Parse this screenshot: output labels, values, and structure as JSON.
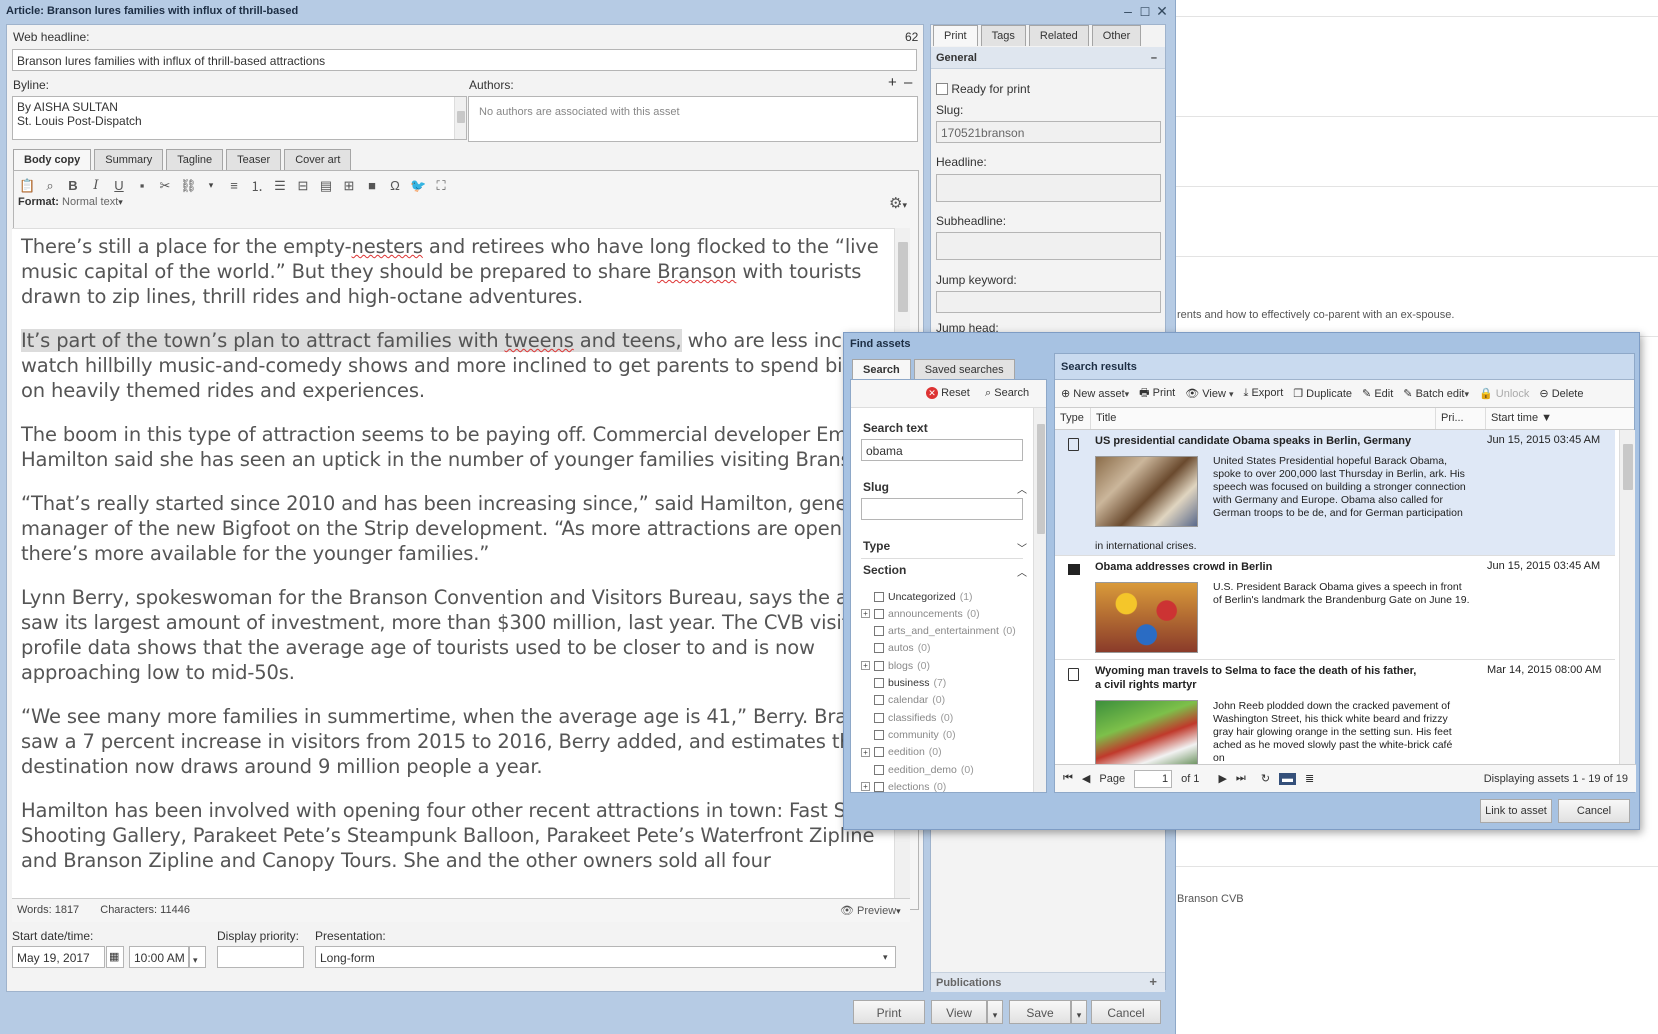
{
  "window": {
    "title": "Article: Branson lures families with influx of thrill-based"
  },
  "web_headline": {
    "label": "Web headline:",
    "count": "62",
    "value": "Branson lures families with influx of thrill-based attractions"
  },
  "byline": {
    "label": "Byline:",
    "line1": "By AISHA SULTAN",
    "line2": "St. Louis Post-Dispatch"
  },
  "authors": {
    "label": "Authors:",
    "empty": "No authors are associated with this asset"
  },
  "editor_tabs": [
    "Body copy",
    "Summary",
    "Tagline",
    "Teaser",
    "Cover art"
  ],
  "format": {
    "label": "Format:",
    "value": "Normal text"
  },
  "body": [
    "There’s still a place for the empty-nesters and retirees who have long flocked to the “live music capital of the world.” But they should be prepared to share Branson with tourists drawn to zip lines, thrill rides and high-octane adventures.",
    "It’s part of the town’s plan to attract families with tweens and teens, who are less inclined to watch hillbilly music-and-comedy shows and more inclined to get parents to spend big bucks on heavily themed rides and experiences.",
    "The boom in this type of attraction seems to be paying off. Commercial developer Emma Hamilton said she has seen an uptick in the number of younger families visiting Branson.",
    "“That’s really started since 2010 and has been increasing since,” said Hamilton, general manager of the new Bigfoot on the Strip development. “As more attractions are opening, there’s more available for the younger families.”",
    "Lynn Berry, spokeswoman for the Branson Convention and Visitors Bureau, says the area saw its largest amount of investment, more than $300 million, last year. The CVB visitor profile data shows that the average age of tourists used to be closer to and is now approaching low to mid-50s.",
    "“We see many more families in summertime, when the average age is 41,” Berry. Branson saw a 7 percent increase in visitors from 2015 to 2016, Berry added, and estimates the destination now draws around 9 million people a year.",
    "Hamilton has been involved with opening four other recent attractions in town: Fast Shot Shooting Gallery, Parakeet Pete’s Steampunk Balloon, Parakeet Pete’s Waterfront Zipline and Branson Zipline and Canopy Tours. She and the other owners sold all four"
  ],
  "stats": {
    "words_label": "Words:",
    "words": "1817",
    "chars_label": "Characters:",
    "chars": "11446",
    "preview": "Preview"
  },
  "start": {
    "label": "Start date/time:",
    "date": "May 19, 2017",
    "time": "10:00 AM"
  },
  "priority": {
    "label": "Display priority:"
  },
  "presentation": {
    "label": "Presentation:",
    "value": "Long-form"
  },
  "bottom_buttons": {
    "print": "Print",
    "view": "View",
    "save": "Save",
    "cancel": "Cancel"
  },
  "right_tabs": [
    "Print",
    "Tags",
    "Related",
    "Other"
  ],
  "general": {
    "header": "General",
    "ready": "Ready for print",
    "slug_label": "Slug:",
    "slug": "170521branson",
    "headline_label": "Headline:",
    "subheadline_label": "Subheadline:",
    "jump_keyword_label": "Jump keyword:",
    "jump_head_label": "Jump head:",
    "publications": "Publications"
  },
  "bg_texts": [
    "rents and how to effectively co-parent with an ex-spouse.",
    "Branson CVB"
  ],
  "find": {
    "title": "Find assets",
    "tabs": [
      "Search",
      "Saved searches"
    ],
    "reset": "Reset",
    "search_btn": "Search",
    "search_text_label": "Search text",
    "search_text": "obama",
    "slug_label": "Slug",
    "type_label": "Type",
    "section_label": "Section",
    "sections": [
      {
        "name": "Uncategorized",
        "count": "(1)",
        "expand": false,
        "dark": true
      },
      {
        "name": "announcements",
        "count": "(0)",
        "expand": true,
        "dark": false
      },
      {
        "name": "arts_and_entertainment",
        "count": "(0)",
        "expand": false,
        "dark": false
      },
      {
        "name": "autos",
        "count": "(0)",
        "expand": false,
        "dark": false
      },
      {
        "name": "blogs",
        "count": "(0)",
        "expand": true,
        "dark": false
      },
      {
        "name": "business",
        "count": "(7)",
        "expand": false,
        "dark": true
      },
      {
        "name": "calendar",
        "count": "(0)",
        "expand": false,
        "dark": false
      },
      {
        "name": "classifieds",
        "count": "(0)",
        "expand": false,
        "dark": false
      },
      {
        "name": "community",
        "count": "(0)",
        "expand": false,
        "dark": false
      },
      {
        "name": "eedition",
        "count": "(0)",
        "expand": true,
        "dark": false
      },
      {
        "name": "eedition_demo",
        "count": "(0)",
        "expand": false,
        "dark": false
      },
      {
        "name": "elections",
        "count": "(0)",
        "expand": true,
        "dark": false
      }
    ],
    "results_title": "Search results",
    "toolbar": {
      "new_asset": "New asset",
      "print": "Print",
      "view": "View",
      "export": "Export",
      "duplicate": "Duplicate",
      "edit": "Edit",
      "batch_edit": "Batch edit",
      "unlock": "Unlock",
      "delete": "Delete"
    },
    "columns": {
      "type": "Type",
      "title": "Title",
      "priority": "Pri...",
      "start": "Start time"
    },
    "results": [
      {
        "title": "US presidential candidate Obama speaks in Berlin, Germany",
        "date": "Jun 15, 2015 03:45 AM",
        "desc": "United States Presidential hopeful Barack Obama, spoke to over 200,000 last Thursday in Berlin, ark. His speech was focused on building a stronger connection with Germany and Europe. Obama also called for German troops to be de, and for German participation",
        "desc_tail": "in international crises."
      },
      {
        "title": "Obama addresses crowd in Berlin",
        "date": "Jun 15, 2015 03:45 AM",
        "desc": "U.S. President Barack Obama gives a speech in front of Berlin's landmark the Brandenburg Gate on June 19."
      },
      {
        "title": "Wyoming man travels to Selma to face the death of his father, a civil rights martyr",
        "date": "Mar 14, 2015 08:00 AM",
        "desc": "John Reeb plodded down the cracked pavement of Washington Street, his thick white beard and frizzy gray hair glowing orange in the setting sun. His feet ached as he moved slowly past the white-brick café on"
      }
    ],
    "pager": {
      "page_label": "Page",
      "page": "1",
      "of": "of 1",
      "display": "Displaying assets 1 - 19 of 19"
    },
    "link_btn": "Link to asset",
    "cancel_btn": "Cancel"
  }
}
